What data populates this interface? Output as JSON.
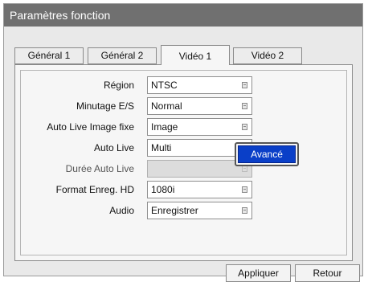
{
  "window": {
    "title": "Paramètres fonction"
  },
  "tabs": [
    {
      "label": "Général 1",
      "active": false
    },
    {
      "label": "Général 2",
      "active": false
    },
    {
      "label": "Vidéo 1",
      "active": true
    },
    {
      "label": "Vidéo 2",
      "active": false
    }
  ],
  "settings": [
    {
      "label": "Région",
      "value": "NTSC",
      "enabled": true
    },
    {
      "label": "Minutage E/S",
      "value": "Normal",
      "enabled": true
    },
    {
      "label": "Auto Live Image fixe",
      "value": "Image",
      "enabled": true
    },
    {
      "label": "Auto Live",
      "value": "Multi",
      "enabled": true
    },
    {
      "label": "Durée Auto Live",
      "value": "",
      "enabled": false
    },
    {
      "label": "Format Enreg. HD",
      "value": "1080i",
      "enabled": true
    },
    {
      "label": "Audio",
      "value": "Enregistrer",
      "enabled": true
    }
  ],
  "advanced_button": {
    "label": "Avancé"
  },
  "footer": {
    "apply_label": "Appliquer",
    "back_label": "Retour"
  },
  "colors": {
    "title_bar": "#707070",
    "accent": "#0a3fc8",
    "window_bg": "#e9e9e9"
  }
}
